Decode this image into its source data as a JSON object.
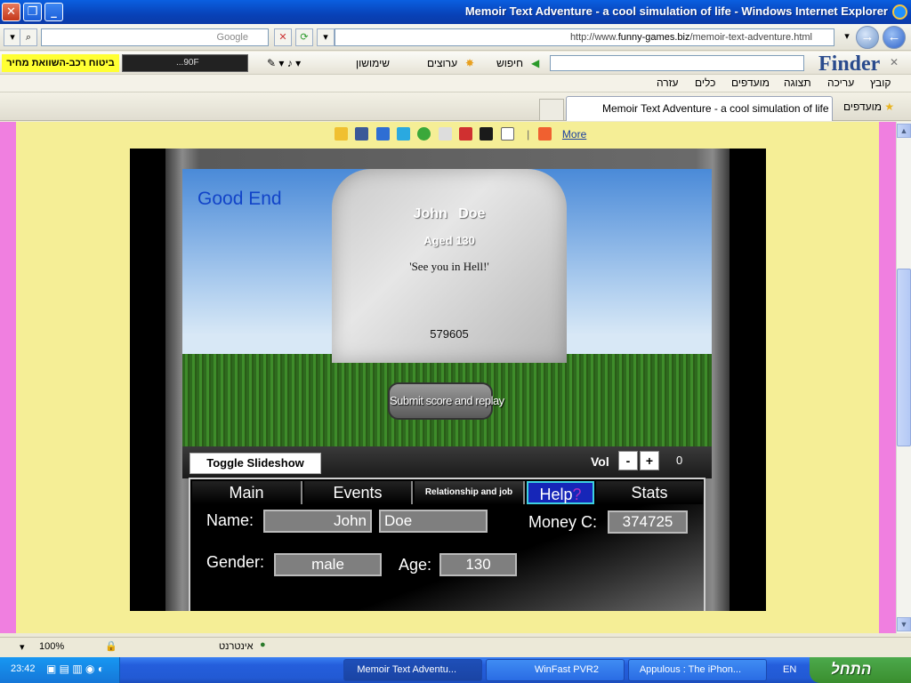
{
  "window": {
    "title": "Memoir Text Adventure - a cool simulation of life - Windows Internet Explorer"
  },
  "address_bar": {
    "url_prefix": "http://www.",
    "url_domain": "funny-games.biz",
    "url_path": "/memoir-text-adventure.html",
    "search_placeholder": "Google"
  },
  "toolbar": {
    "yellow_ad": "ביטוח רכב-השוואת מחיר",
    "media_text": "...90F",
    "finder": "Finder",
    "items": [
      "חיפוש",
      "ערוצים",
      "שימושון"
    ]
  },
  "menu": [
    "קובץ",
    "עריכה",
    "תצוגה",
    "מועדפים",
    "כלים",
    "עזרה"
  ],
  "tabs": {
    "favorites": "מועדפים",
    "active": "Memoir Text Adventure - a cool simulation of life"
  },
  "share": {
    "more": "More"
  },
  "game": {
    "ending": "Good End",
    "epitaph_name": "John Doe",
    "epitaph_age": "Aged 130",
    "epitaph_quote": "'See you in Hell!'",
    "score": "579605",
    "submit_label": "Submit score and replay",
    "toggle_label": "Toggle Slideshow",
    "vol_label": "Vol",
    "vol_minus": "-",
    "vol_plus": "+",
    "vol_value": "0",
    "tabs": [
      "Main",
      "Events",
      "Relationship and job",
      "Help",
      "Stats"
    ],
    "help_q": "?",
    "fields": {
      "name_label": "Name:",
      "first_name": "John",
      "last_name": "Doe",
      "money_label": "Money C:",
      "money": "374725",
      "gender_label": "Gender:",
      "gender": "male",
      "age_label": "Age:",
      "age": "130"
    }
  },
  "statusbar": {
    "zone": "אינטרנט",
    "zoom": "100%"
  },
  "taskbar": {
    "start": "התחל",
    "clock": "23:42",
    "lang": "EN",
    "buttons": [
      "Memoir Text Adventu...",
      "WinFast PVR2",
      "Appulous : The iPhon..."
    ]
  },
  "colors": {
    "page_bg": "#F5EE96",
    "side_pink": "#F07FE0",
    "good_end": "#1244C8",
    "help_tab": "#1626B8"
  }
}
